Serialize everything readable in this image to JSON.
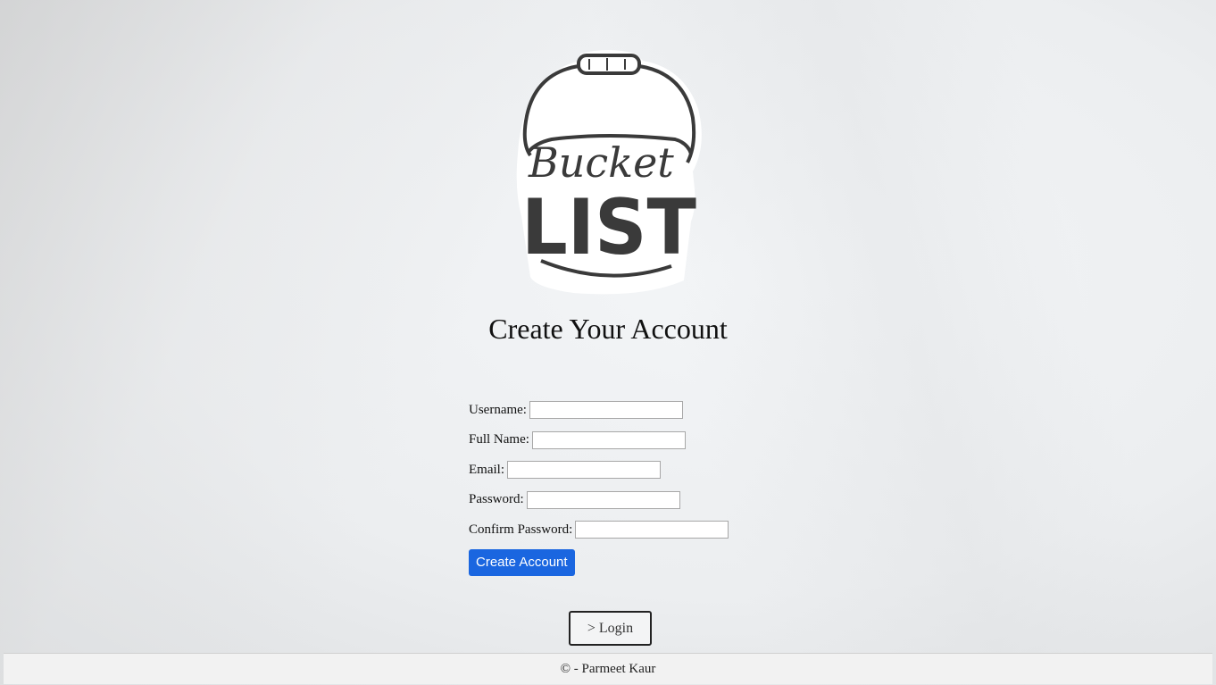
{
  "logo": {
    "word_script": "Bucket",
    "word_block": "LIST",
    "icon": "bucket-icon"
  },
  "page_title": "Create Your Account",
  "form": {
    "fields": [
      {
        "label": "Username:",
        "value": ""
      },
      {
        "label": "Full Name:",
        "value": ""
      },
      {
        "label": "Email:",
        "value": ""
      },
      {
        "label": "Password:",
        "value": ""
      },
      {
        "label": "Confirm Password:",
        "value": ""
      }
    ],
    "submit_label": "Create Account"
  },
  "login_link": "> Login",
  "footer": {
    "text": "© - Parmeet Kaur"
  },
  "colors": {
    "primary_button": "#1a66e0",
    "logo_ink": "#3a3a3a"
  }
}
